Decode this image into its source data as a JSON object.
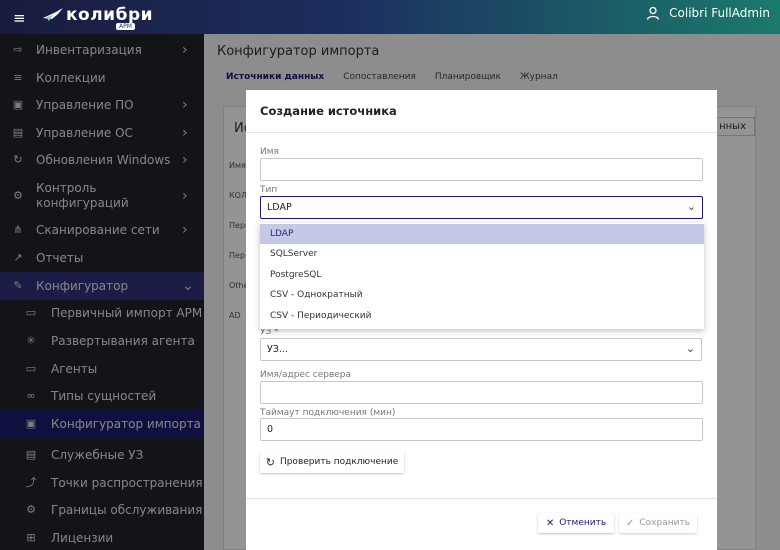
{
  "app": {
    "logo_text": "колибри",
    "logo_badge": "АРМ",
    "user_name": "Colibri FullAdmin"
  },
  "sidebar": {
    "items": [
      {
        "label": "Инвентаризация",
        "icon": "inventory-icon",
        "chevron": true
      },
      {
        "label": "Коллекции",
        "icon": "list-icon",
        "chevron": false
      },
      {
        "label": "Управление ПО",
        "icon": "software-icon",
        "chevron": true
      },
      {
        "label": "Управление ОС",
        "icon": "os-icon",
        "chevron": true
      },
      {
        "label": "Обновления Windows",
        "icon": "sync-icon",
        "chevron": true
      },
      {
        "label": "Контроль конфигураций",
        "icon": "config-control-icon",
        "chevron": true
      },
      {
        "label": "Сканирование сети",
        "icon": "network-icon",
        "chevron": true
      },
      {
        "label": "Отчеты",
        "icon": "chart-icon",
        "chevron": false
      },
      {
        "label": "Конфигуратор",
        "icon": "wrench-icon",
        "chevron": true
      }
    ],
    "sub_items": [
      {
        "label": "Первичный импорт АРМ",
        "icon": "import-icon"
      },
      {
        "label": "Развертывания агента",
        "icon": "deploy-icon"
      },
      {
        "label": "Агенты",
        "icon": "monitor-icon"
      },
      {
        "label": "Типы сущностей",
        "icon": "entities-icon"
      },
      {
        "label": "Конфигуратор импорта",
        "icon": "import-config-icon"
      },
      {
        "label": "Служебные УЗ",
        "icon": "service-account-icon"
      },
      {
        "label": "Точки распространения",
        "icon": "distribution-icon"
      },
      {
        "label": "Границы обслуживания",
        "icon": "boundary-icon"
      },
      {
        "label": "Лицензии",
        "icon": "license-icon"
      }
    ]
  },
  "main": {
    "title": "Конфигуратор импорта",
    "tabs": [
      "Источники данных",
      "Сопоставления",
      "Планировщик",
      "Журнал"
    ],
    "bg_card": {
      "heading": "Ис",
      "button": "нных",
      "column": "Имя",
      "rows": [
        "КОЛ",
        "Перв",
        "Пер",
        "Othe",
        "AD"
      ]
    }
  },
  "modal": {
    "title": "Создание источника",
    "name_label": "Имя",
    "name_value": "",
    "type_label": "Тип",
    "type_value": "LDAP",
    "type_options": [
      "LDAP",
      "SQLServer",
      "PostgreSQL",
      "CSV - Однократный",
      "CSV - Периодический"
    ],
    "account_label": "УЗ *",
    "account_placeholder": "УЗ...",
    "server_label": "Имя/адрес сервера",
    "server_value": "",
    "timeout_label": "Таймаут подключения (мин)",
    "timeout_value": "0",
    "test_button": "Проверить подключение",
    "cancel_button": "Отменить",
    "save_button": "Сохранить"
  },
  "colors": {
    "accent": "#1c1c6e",
    "sidebar_bg": "#22232a",
    "selected_option": "#c5c8e6"
  }
}
